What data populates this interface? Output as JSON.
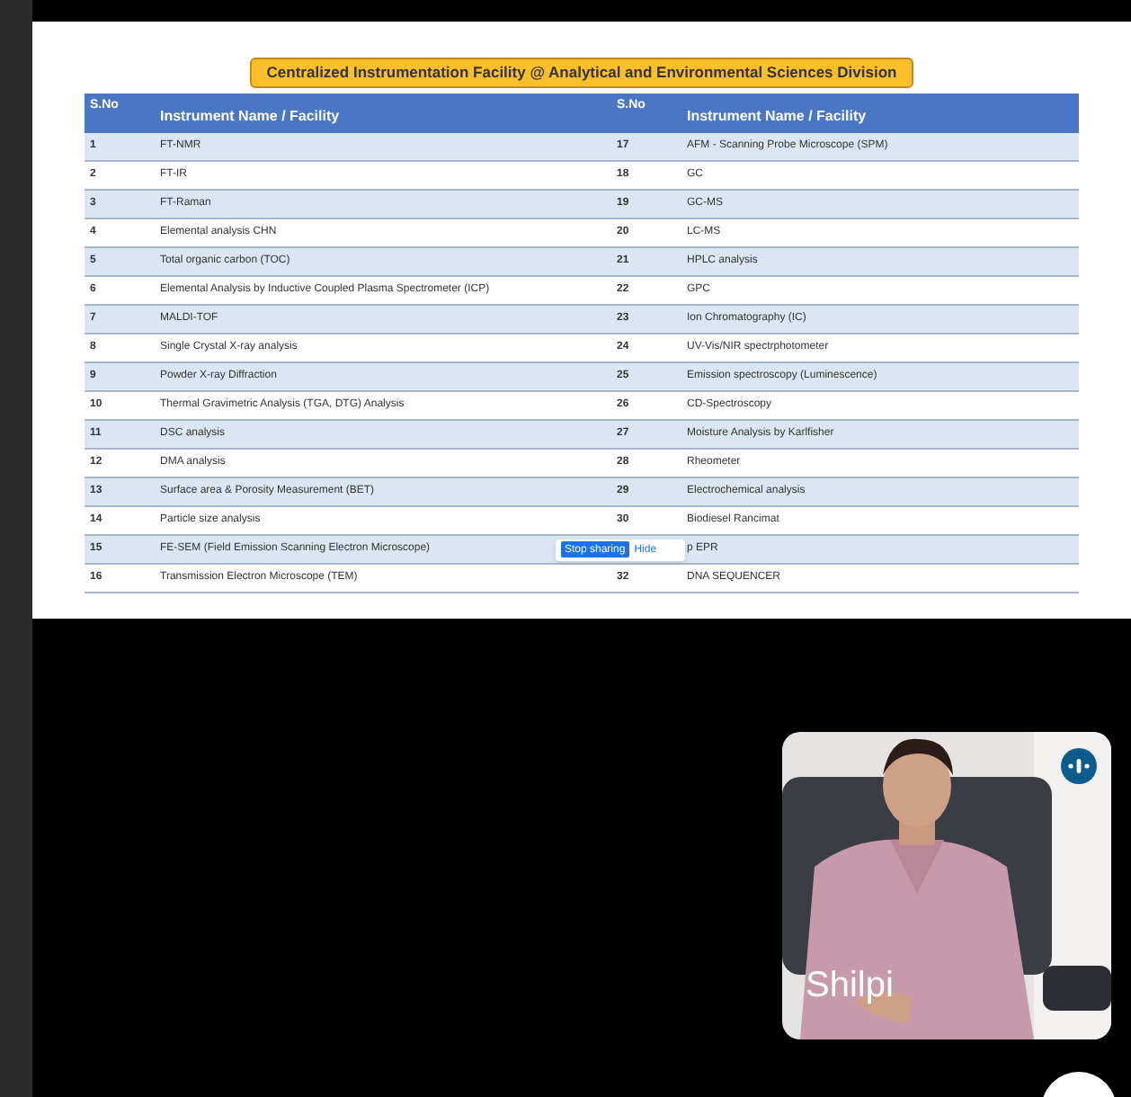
{
  "slide": {
    "title": "Centralized Instrumentation Facility @ Analytical and Environmental Sciences Division",
    "columns": [
      "S.No",
      "Instrument Name / Facility",
      "S.No",
      "Instrument Name / Facility"
    ],
    "rows": [
      {
        "left_no": "1",
        "left_name": "FT-NMR",
        "right_no": "17",
        "right_name": "AFM - Scanning Probe Microscope (SPM)"
      },
      {
        "left_no": "2",
        "left_name": "FT-IR",
        "right_no": "18",
        "right_name": "GC"
      },
      {
        "left_no": "3",
        "left_name": "FT-Raman",
        "right_no": "19",
        "right_name": "GC-MS"
      },
      {
        "left_no": "4",
        "left_name": "Elemental analysis CHN",
        "right_no": "20",
        "right_name": "LC-MS"
      },
      {
        "left_no": "5",
        "left_name": "Total organic carbon (TOC)",
        "right_no": "21",
        "right_name": "HPLC analysis"
      },
      {
        "left_no": "6",
        "left_name": "Elemental Analysis by Inductive Coupled Plasma Spectrometer (ICP)",
        "right_no": "22",
        "right_name": "GPC"
      },
      {
        "left_no": "7",
        "left_name": "MALDI-TOF",
        "right_no": "23",
        "right_name": "Ion Chromatography (IC)"
      },
      {
        "left_no": "8",
        "left_name": "Single Crystal X-ray analysis",
        "right_no": "24",
        "right_name": "UV-Vis/NIR spectrphotometer"
      },
      {
        "left_no": "9",
        "left_name": "Powder X-ray Diffraction",
        "right_no": "25",
        "right_name": "Emission spectroscopy (Luminescence)"
      },
      {
        "left_no": "10",
        "left_name": "Thermal Gravimetric Analysis (TGA, DTG) Analysis",
        "right_no": "26",
        "right_name": "CD-Spectroscopy"
      },
      {
        "left_no": "11",
        "left_name": "DSC analysis",
        "right_no": "27",
        "right_name": "Moisture Analysis by Karlfisher"
      },
      {
        "left_no": "12",
        "left_name": "DMA analysis",
        "right_no": "28",
        "right_name": "Rheometer"
      },
      {
        "left_no": "13",
        "left_name": "Surface area & Porosity Measurement (BET)",
        "right_no": "29",
        "right_name": "Electrochemical analysis"
      },
      {
        "left_no": "14",
        "left_name": "Particle size analysis",
        "right_no": "30",
        "right_name": "Biodiesel Rancimat"
      },
      {
        "left_no": "15",
        "left_name": "FE-SEM (Field Emission Scanning Electron Microscope)",
        "right_name": "p EPR",
        "share_bar": {
          "button": "Stop sharing",
          "hide": "Hide"
        }
      },
      {
        "left_no": "16",
        "left_name": "Transmission Electron Microscope (TEM)",
        "right_no": "32",
        "right_name": "DNA SEQUENCER"
      }
    ]
  },
  "video_tile": {
    "name": "Shilpi",
    "speaking": true
  }
}
